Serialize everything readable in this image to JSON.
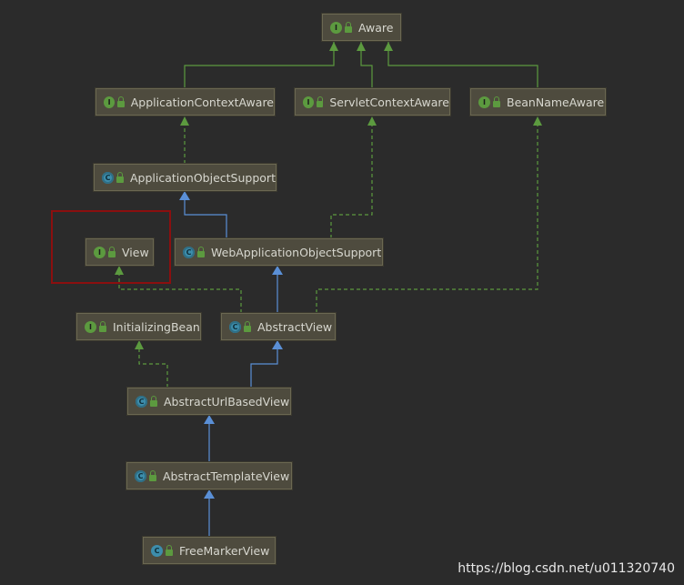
{
  "diagram": {
    "nodes": {
      "aware": {
        "label": "Aware",
        "kind": "interface",
        "badge": "I"
      },
      "application_context_aware": {
        "label": "ApplicationContextAware",
        "kind": "interface",
        "badge": "I"
      },
      "servlet_context_aware": {
        "label": "ServletContextAware",
        "kind": "interface",
        "badge": "I"
      },
      "bean_name_aware": {
        "label": "BeanNameAware",
        "kind": "interface",
        "badge": "I"
      },
      "application_object_support": {
        "label": "ApplicationObjectSupport",
        "kind": "abstract-class",
        "badge": "C"
      },
      "view": {
        "label": "View",
        "kind": "interface",
        "badge": "I"
      },
      "web_application_object_support": {
        "label": "WebApplicationObjectSupport",
        "kind": "abstract-class",
        "badge": "C"
      },
      "initializing_bean": {
        "label": "InitializingBean",
        "kind": "interface",
        "badge": "I"
      },
      "abstract_view": {
        "label": "AbstractView",
        "kind": "abstract-class",
        "badge": "C"
      },
      "abstract_url_based_view": {
        "label": "AbstractUrlBasedView",
        "kind": "abstract-class",
        "badge": "C"
      },
      "abstract_template_view": {
        "label": "AbstractTemplateView",
        "kind": "abstract-class",
        "badge": "C"
      },
      "freemarker_view": {
        "label": "FreeMarkerView",
        "kind": "class",
        "badge": "C"
      }
    },
    "edges": [
      {
        "from": "application_context_aware",
        "to": "aware",
        "type": "extends-interface"
      },
      {
        "from": "servlet_context_aware",
        "to": "aware",
        "type": "extends-interface"
      },
      {
        "from": "bean_name_aware",
        "to": "aware",
        "type": "extends-interface"
      },
      {
        "from": "application_object_support",
        "to": "application_context_aware",
        "type": "implements"
      },
      {
        "from": "web_application_object_support",
        "to": "application_object_support",
        "type": "extends"
      },
      {
        "from": "web_application_object_support",
        "to": "servlet_context_aware",
        "type": "implements"
      },
      {
        "from": "abstract_view",
        "to": "web_application_object_support",
        "type": "extends"
      },
      {
        "from": "abstract_view",
        "to": "view",
        "type": "implements"
      },
      {
        "from": "abstract_view",
        "to": "bean_name_aware",
        "type": "implements"
      },
      {
        "from": "abstract_url_based_view",
        "to": "abstract_view",
        "type": "extends"
      },
      {
        "from": "abstract_url_based_view",
        "to": "initializing_bean",
        "type": "implements"
      },
      {
        "from": "abstract_template_view",
        "to": "abstract_url_based_view",
        "type": "extends"
      },
      {
        "from": "freemarker_view",
        "to": "abstract_template_view",
        "type": "extends"
      }
    ],
    "highlighted_node": "view",
    "colors": {
      "background": "#2b2b2b",
      "node_fill": "#4e4b3e",
      "extends_edge": "#5a8fd6",
      "implements_edge": "#5c9a3f",
      "highlight": "#8b0f0f"
    }
  },
  "watermark": "https://blog.csdn.net/u011320740"
}
